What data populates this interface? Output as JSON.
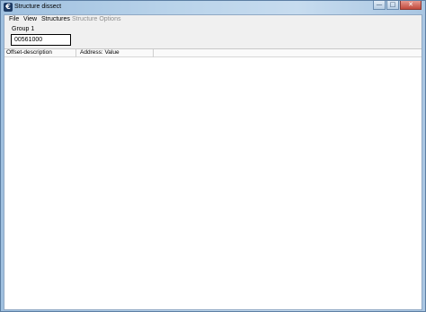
{
  "window": {
    "title": "Structure dissect",
    "app_icon_glyph": "€",
    "caption": {
      "minimize": "—",
      "maximize": "□",
      "close": "✕"
    }
  },
  "menu": {
    "file": "File",
    "view": "View",
    "structures": "Structures",
    "structure_options": "Structure Options"
  },
  "group": {
    "label": "Group 1",
    "address_value": "00561000"
  },
  "list": {
    "columns": [
      "Offset-description",
      "Address: Value"
    ]
  }
}
